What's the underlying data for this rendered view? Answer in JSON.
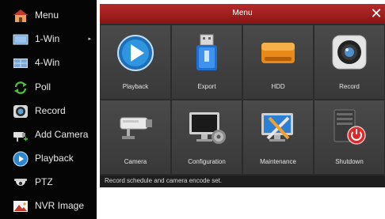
{
  "sidebar": {
    "items": [
      {
        "label": "Menu",
        "icon": "home-icon",
        "has_submenu": false
      },
      {
        "label": "1-Win",
        "icon": "single-window-icon",
        "has_submenu": true
      },
      {
        "label": "4-Win",
        "icon": "quad-window-icon",
        "has_submenu": false
      },
      {
        "label": "Poll",
        "icon": "cycle-arrows-icon",
        "has_submenu": false
      },
      {
        "label": "Record",
        "icon": "record-icon",
        "has_submenu": false
      },
      {
        "label": "Add Camera",
        "icon": "add-camera-icon",
        "has_submenu": false
      },
      {
        "label": "Playback",
        "icon": "playback-icon",
        "has_submenu": false
      },
      {
        "label": "PTZ",
        "icon": "ptz-icon",
        "has_submenu": false
      },
      {
        "label": "NVR Image",
        "icon": "image-icon",
        "has_submenu": false
      }
    ],
    "submenu_arrow": "▸"
  },
  "panel": {
    "title": "Menu",
    "close_glyph": "✕",
    "tiles": [
      {
        "label": "Playback",
        "icon": "playback-icon"
      },
      {
        "label": "Export",
        "icon": "usb-drive-icon"
      },
      {
        "label": "HDD",
        "icon": "hard-drive-icon"
      },
      {
        "label": "Record",
        "icon": "record-icon"
      },
      {
        "label": "Camera",
        "icon": "camera-icon"
      },
      {
        "label": "Configuration",
        "icon": "configuration-icon"
      },
      {
        "label": "Maintenance",
        "icon": "maintenance-icon"
      },
      {
        "label": "Shutdown",
        "icon": "shutdown-icon"
      }
    ],
    "status": "Record schedule and camera encode set."
  },
  "colors": {
    "titlebar": "#9e1f1f",
    "sidebar_bg": "#050505",
    "tile_bg": "#444444"
  }
}
